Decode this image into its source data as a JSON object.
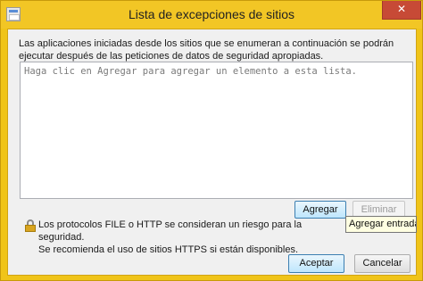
{
  "window": {
    "title": "Lista de excepciones de sitios",
    "close_glyph": "✕"
  },
  "description": "Las aplicaciones iniciadas desde los sitios que se enumeran a continuación se podrán ejecutar después de las peticiones de datos de seguridad apropiadas.",
  "list": {
    "placeholder": "Haga clic en Agregar para agregar un elemento a esta lista."
  },
  "buttons": {
    "add": "Agregar",
    "remove": "Eliminar",
    "ok": "Aceptar",
    "cancel": "Cancelar"
  },
  "tooltip": "Agregar entradas a",
  "warning": {
    "line1": "Los protocolos FILE o HTTP se consideran un riesgo para la seguridad.",
    "line2": "Se recomienda el uso de sitios HTTPS si están disponibles."
  },
  "colors": {
    "titlebar": "#f2c625",
    "close_button": "#c74a36",
    "dialog_bg": "#f0f0f0"
  },
  "icons": {
    "app": "java-app-icon",
    "close": "close-icon",
    "warning": "lock-icon"
  }
}
